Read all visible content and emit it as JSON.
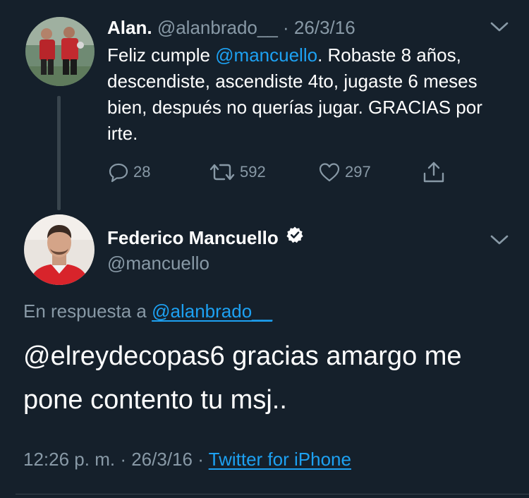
{
  "parent_tweet": {
    "author_name": "Alan.",
    "handle": "@alanbrado__",
    "separator": "·",
    "date": "26/3/16",
    "text_before_mention": "Feliz cumple ",
    "mention": "@mancuello",
    "text_after_mention": ". Robaste 8 años, descendiste, ascendiste 4to, jugaste 6 meses bien, después no querías jugar. GRACIAS por irte.",
    "replies": "28",
    "retweets": "592",
    "likes": "297"
  },
  "reply_tweet": {
    "author_name": "Federico Mancuello",
    "handle": "@mancuello",
    "reply_to_prefix": "En respuesta a",
    "reply_to_handle": "@alanbrado__",
    "text": "@elreydecopas6 gracias amargo me pone contento tu msj..",
    "time": "12:26 p. m.",
    "separator": "·",
    "date": "26/3/16",
    "source": "Twitter for iPhone"
  },
  "colors": {
    "background": "#15202b",
    "text": "#ffffff",
    "muted": "#8899a6",
    "link": "#1da1f2",
    "divider": "#38444d"
  },
  "icons": [
    "reply-icon",
    "retweet-icon",
    "like-icon",
    "share-icon",
    "chevron-down-icon",
    "verified-badge-icon"
  ]
}
